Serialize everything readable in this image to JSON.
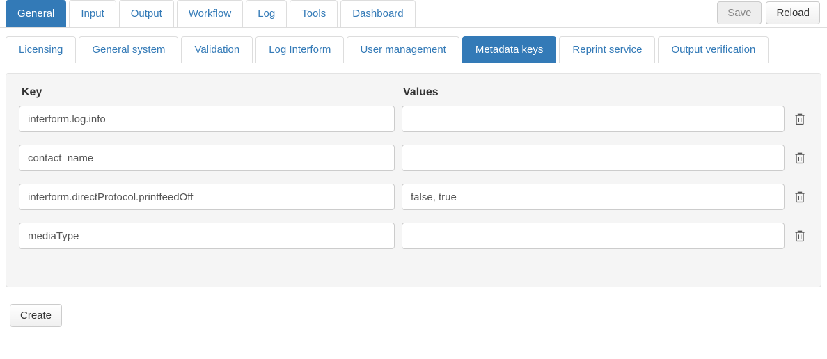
{
  "top_tabs": [
    {
      "id": "general",
      "label": "General",
      "active": true
    },
    {
      "id": "input",
      "label": "Input",
      "active": false
    },
    {
      "id": "output",
      "label": "Output",
      "active": false
    },
    {
      "id": "workflow",
      "label": "Workflow",
      "active": false
    },
    {
      "id": "log",
      "label": "Log",
      "active": false
    },
    {
      "id": "tools",
      "label": "Tools",
      "active": false
    },
    {
      "id": "dashboard",
      "label": "Dashboard",
      "active": false
    }
  ],
  "actions": {
    "save_label": "Save",
    "save_disabled": true,
    "reload_label": "Reload"
  },
  "sub_tabs": [
    {
      "id": "licensing",
      "label": "Licensing",
      "active": false
    },
    {
      "id": "general-system",
      "label": "General system",
      "active": false
    },
    {
      "id": "validation",
      "label": "Validation",
      "active": false
    },
    {
      "id": "log-interform",
      "label": "Log Interform",
      "active": false
    },
    {
      "id": "user-management",
      "label": "User management",
      "active": false
    },
    {
      "id": "metadata-keys",
      "label": "Metadata keys",
      "active": true
    },
    {
      "id": "reprint-service",
      "label": "Reprint service",
      "active": false
    },
    {
      "id": "output-verification",
      "label": "Output verification",
      "active": false
    }
  ],
  "table": {
    "key_header": "Key",
    "values_header": "Values",
    "rows": [
      {
        "key": "interform.log.info",
        "values": ""
      },
      {
        "key": "contact_name",
        "values": ""
      },
      {
        "key": "interform.directProtocol.printfeedOff",
        "values": "false, true"
      },
      {
        "key": "mediaType",
        "values": ""
      }
    ]
  },
  "create_label": "Create"
}
